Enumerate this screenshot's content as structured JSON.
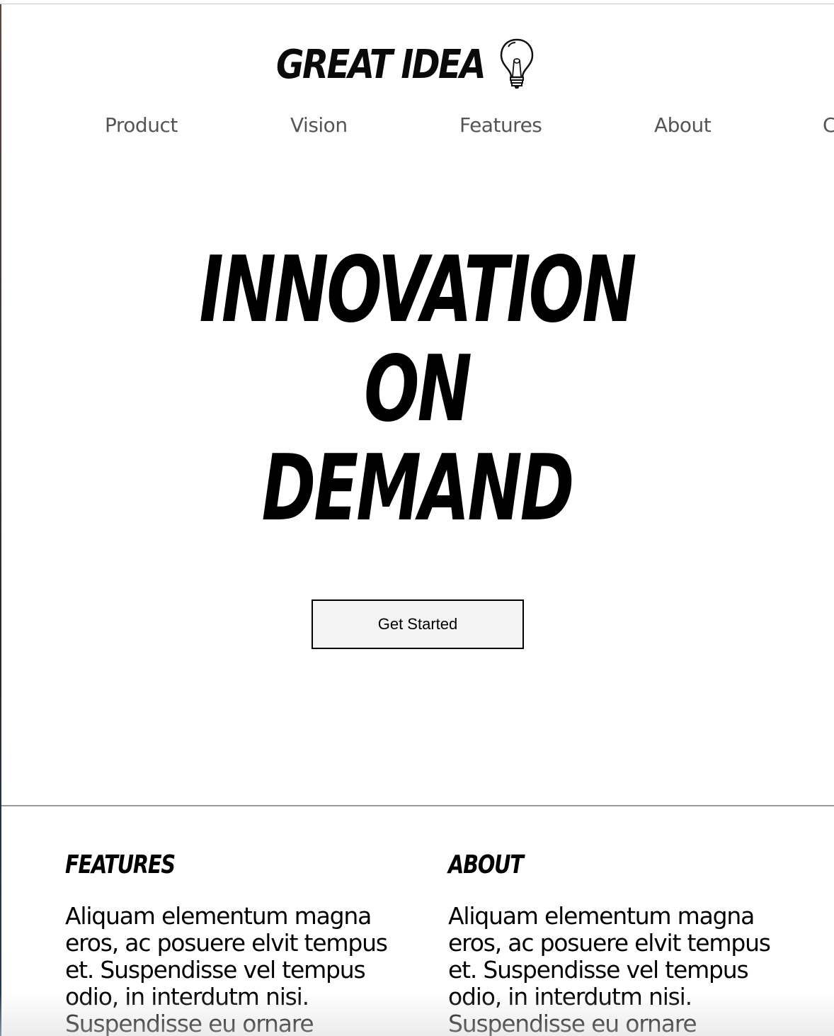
{
  "logo": {
    "text": "GREAT IDEA",
    "icon": "lightbulb-icon"
  },
  "nav": {
    "items": [
      {
        "label": "Product"
      },
      {
        "label": "Vision"
      },
      {
        "label": "Features"
      },
      {
        "label": "About"
      },
      {
        "label": "C"
      }
    ]
  },
  "hero": {
    "title_lines": [
      "INNOVATION",
      "ON",
      "DEMAND"
    ],
    "cta_label": "Get Started"
  },
  "sections": [
    {
      "heading": "FEATURES",
      "body": "Aliquam elementum magna eros, ac posuere elvit tempus et. Suspendisse vel tempus odio, in interdutm nisi. Suspendisse eu ornare"
    },
    {
      "heading": "ABOUT",
      "body": "Aliquam elementum magna eros, ac posuere elvit tempus et. Suspendisse vel tempus odio, in interdutm nisi. Suspendisse eu ornare"
    }
  ],
  "colors": {
    "text": "#000000",
    "nav_text": "#555555",
    "button_bg": "#f3f3f3",
    "divider": "#9a9a9a"
  }
}
